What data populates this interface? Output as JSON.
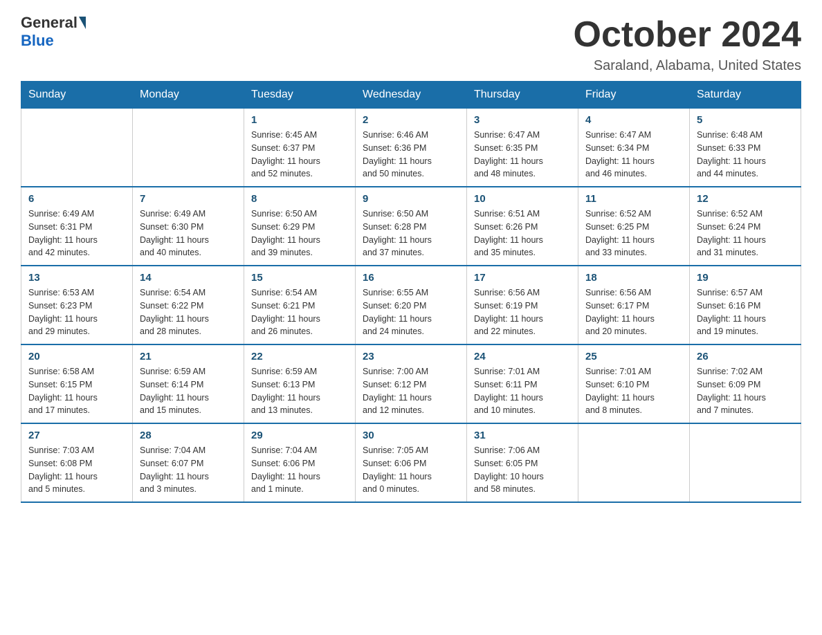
{
  "header": {
    "logo": {
      "general": "General",
      "blue": "Blue"
    },
    "title": "October 2024",
    "location": "Saraland, Alabama, United States"
  },
  "weekdays": [
    "Sunday",
    "Monday",
    "Tuesday",
    "Wednesday",
    "Thursday",
    "Friday",
    "Saturday"
  ],
  "weeks": [
    [
      {
        "day": "",
        "info": ""
      },
      {
        "day": "",
        "info": ""
      },
      {
        "day": "1",
        "info": "Sunrise: 6:45 AM\nSunset: 6:37 PM\nDaylight: 11 hours\nand 52 minutes."
      },
      {
        "day": "2",
        "info": "Sunrise: 6:46 AM\nSunset: 6:36 PM\nDaylight: 11 hours\nand 50 minutes."
      },
      {
        "day": "3",
        "info": "Sunrise: 6:47 AM\nSunset: 6:35 PM\nDaylight: 11 hours\nand 48 minutes."
      },
      {
        "day": "4",
        "info": "Sunrise: 6:47 AM\nSunset: 6:34 PM\nDaylight: 11 hours\nand 46 minutes."
      },
      {
        "day": "5",
        "info": "Sunrise: 6:48 AM\nSunset: 6:33 PM\nDaylight: 11 hours\nand 44 minutes."
      }
    ],
    [
      {
        "day": "6",
        "info": "Sunrise: 6:49 AM\nSunset: 6:31 PM\nDaylight: 11 hours\nand 42 minutes."
      },
      {
        "day": "7",
        "info": "Sunrise: 6:49 AM\nSunset: 6:30 PM\nDaylight: 11 hours\nand 40 minutes."
      },
      {
        "day": "8",
        "info": "Sunrise: 6:50 AM\nSunset: 6:29 PM\nDaylight: 11 hours\nand 39 minutes."
      },
      {
        "day": "9",
        "info": "Sunrise: 6:50 AM\nSunset: 6:28 PM\nDaylight: 11 hours\nand 37 minutes."
      },
      {
        "day": "10",
        "info": "Sunrise: 6:51 AM\nSunset: 6:26 PM\nDaylight: 11 hours\nand 35 minutes."
      },
      {
        "day": "11",
        "info": "Sunrise: 6:52 AM\nSunset: 6:25 PM\nDaylight: 11 hours\nand 33 minutes."
      },
      {
        "day": "12",
        "info": "Sunrise: 6:52 AM\nSunset: 6:24 PM\nDaylight: 11 hours\nand 31 minutes."
      }
    ],
    [
      {
        "day": "13",
        "info": "Sunrise: 6:53 AM\nSunset: 6:23 PM\nDaylight: 11 hours\nand 29 minutes."
      },
      {
        "day": "14",
        "info": "Sunrise: 6:54 AM\nSunset: 6:22 PM\nDaylight: 11 hours\nand 28 minutes."
      },
      {
        "day": "15",
        "info": "Sunrise: 6:54 AM\nSunset: 6:21 PM\nDaylight: 11 hours\nand 26 minutes."
      },
      {
        "day": "16",
        "info": "Sunrise: 6:55 AM\nSunset: 6:20 PM\nDaylight: 11 hours\nand 24 minutes."
      },
      {
        "day": "17",
        "info": "Sunrise: 6:56 AM\nSunset: 6:19 PM\nDaylight: 11 hours\nand 22 minutes."
      },
      {
        "day": "18",
        "info": "Sunrise: 6:56 AM\nSunset: 6:17 PM\nDaylight: 11 hours\nand 20 minutes."
      },
      {
        "day": "19",
        "info": "Sunrise: 6:57 AM\nSunset: 6:16 PM\nDaylight: 11 hours\nand 19 minutes."
      }
    ],
    [
      {
        "day": "20",
        "info": "Sunrise: 6:58 AM\nSunset: 6:15 PM\nDaylight: 11 hours\nand 17 minutes."
      },
      {
        "day": "21",
        "info": "Sunrise: 6:59 AM\nSunset: 6:14 PM\nDaylight: 11 hours\nand 15 minutes."
      },
      {
        "day": "22",
        "info": "Sunrise: 6:59 AM\nSunset: 6:13 PM\nDaylight: 11 hours\nand 13 minutes."
      },
      {
        "day": "23",
        "info": "Sunrise: 7:00 AM\nSunset: 6:12 PM\nDaylight: 11 hours\nand 12 minutes."
      },
      {
        "day": "24",
        "info": "Sunrise: 7:01 AM\nSunset: 6:11 PM\nDaylight: 11 hours\nand 10 minutes."
      },
      {
        "day": "25",
        "info": "Sunrise: 7:01 AM\nSunset: 6:10 PM\nDaylight: 11 hours\nand 8 minutes."
      },
      {
        "day": "26",
        "info": "Sunrise: 7:02 AM\nSunset: 6:09 PM\nDaylight: 11 hours\nand 7 minutes."
      }
    ],
    [
      {
        "day": "27",
        "info": "Sunrise: 7:03 AM\nSunset: 6:08 PM\nDaylight: 11 hours\nand 5 minutes."
      },
      {
        "day": "28",
        "info": "Sunrise: 7:04 AM\nSunset: 6:07 PM\nDaylight: 11 hours\nand 3 minutes."
      },
      {
        "day": "29",
        "info": "Sunrise: 7:04 AM\nSunset: 6:06 PM\nDaylight: 11 hours\nand 1 minute."
      },
      {
        "day": "30",
        "info": "Sunrise: 7:05 AM\nSunset: 6:06 PM\nDaylight: 11 hours\nand 0 minutes."
      },
      {
        "day": "31",
        "info": "Sunrise: 7:06 AM\nSunset: 6:05 PM\nDaylight: 10 hours\nand 58 minutes."
      },
      {
        "day": "",
        "info": ""
      },
      {
        "day": "",
        "info": ""
      }
    ]
  ]
}
